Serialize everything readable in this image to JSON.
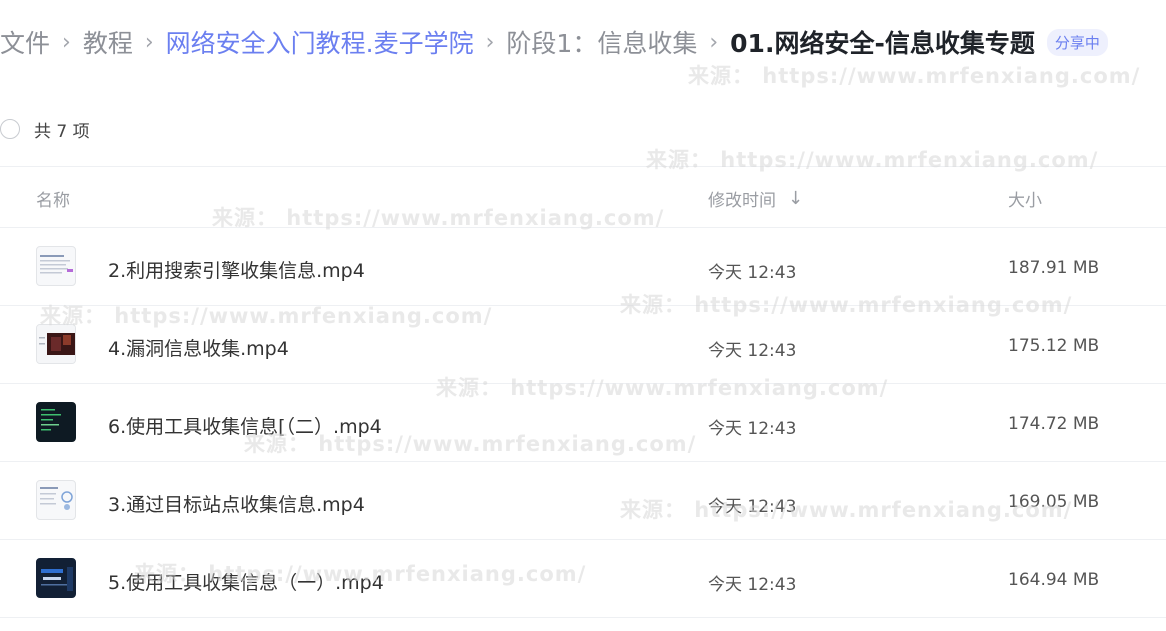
{
  "breadcrumb": {
    "items": [
      "文件",
      "教程",
      "网络安全入门教程.麦子学院",
      "阶段1：信息收集",
      "01.网络安全-信息收集专题"
    ],
    "separator": "›",
    "share_badge": "分享中"
  },
  "summary": {
    "count_text": "共 7 项"
  },
  "table": {
    "headers": {
      "name": "名称",
      "modified": "修改时间",
      "size": "大小"
    },
    "rows": [
      {
        "name": "2.利用搜索引擎收集信息.mp4",
        "modified": "今天 12:43",
        "size": "187.91 MB"
      },
      {
        "name": "4.漏洞信息收集.mp4",
        "modified": "今天 12:43",
        "size": "175.12 MB"
      },
      {
        "name": "6.使用工具收集信息[（二）.mp4",
        "modified": "今天 12:43",
        "size": "174.72 MB"
      },
      {
        "name": "3.通过目标站点收集信息.mp4",
        "modified": "今天 12:43",
        "size": "169.05 MB"
      },
      {
        "name": "5.使用工具收集信息（一）.mp4",
        "modified": "今天 12:43",
        "size": "164.94 MB"
      }
    ]
  },
  "watermark": "来源： https://www.mrfenxiang.com/",
  "colors": {
    "accent": "#6b7ff0",
    "breadcrumb_muted": "#8d9097",
    "current": "#1f2329",
    "divider": "#eef0f3"
  },
  "icons": {
    "sort": "arrow-down-icon",
    "select": "circle-checkbox-icon"
  }
}
